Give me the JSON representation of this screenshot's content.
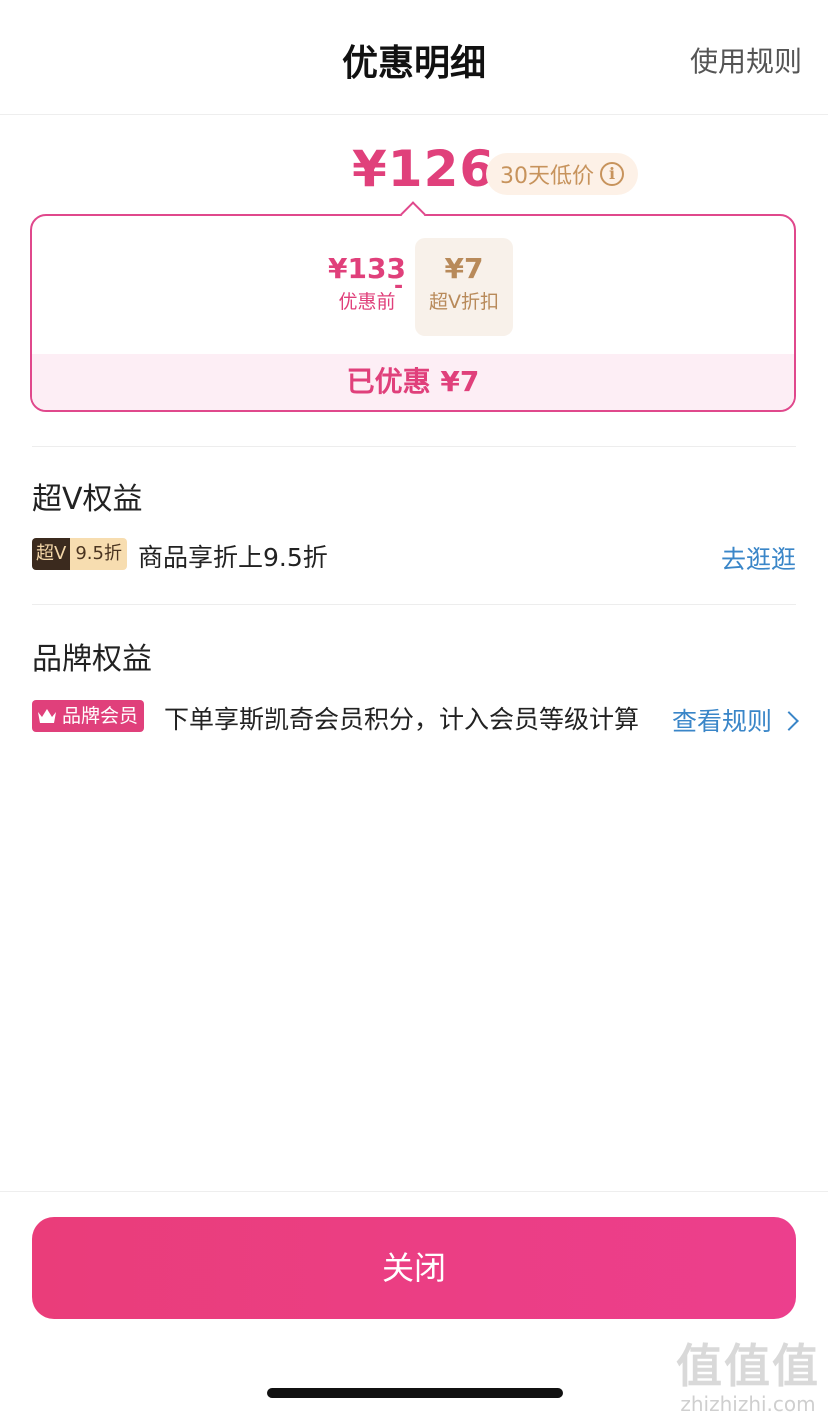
{
  "header": {
    "title": "优惠明细",
    "rules_link": "使用规则"
  },
  "price": {
    "final": "¥126",
    "low_price_badge": "30天低价"
  },
  "breakdown": {
    "original_amount": "¥133",
    "original_label": "优惠前",
    "operator": "-",
    "discount_amount": "¥7",
    "discount_label": "超V折扣",
    "saved_text": "已优惠 ¥7"
  },
  "svip_section": {
    "title": "超V权益",
    "tag_dark": "超V",
    "tag_light": "9.5折",
    "text": "商品享折上9.5折",
    "link": "去逛逛"
  },
  "brand_section": {
    "title": "品牌权益",
    "tag": "品牌会员",
    "text": "下单享斯凯奇会员积分，计入会员等级计算",
    "link": "查看规则"
  },
  "close_button": "关闭",
  "watermark": {
    "glyphs": "值值值",
    "url": "zhizhizhi.com"
  },
  "colors": {
    "accent_pink": "#e0407b",
    "link_blue": "#3a86c8",
    "gold": "#c7935c"
  },
  "icons": [
    "info-icon",
    "crown-icon",
    "chevron-right-icon"
  ]
}
